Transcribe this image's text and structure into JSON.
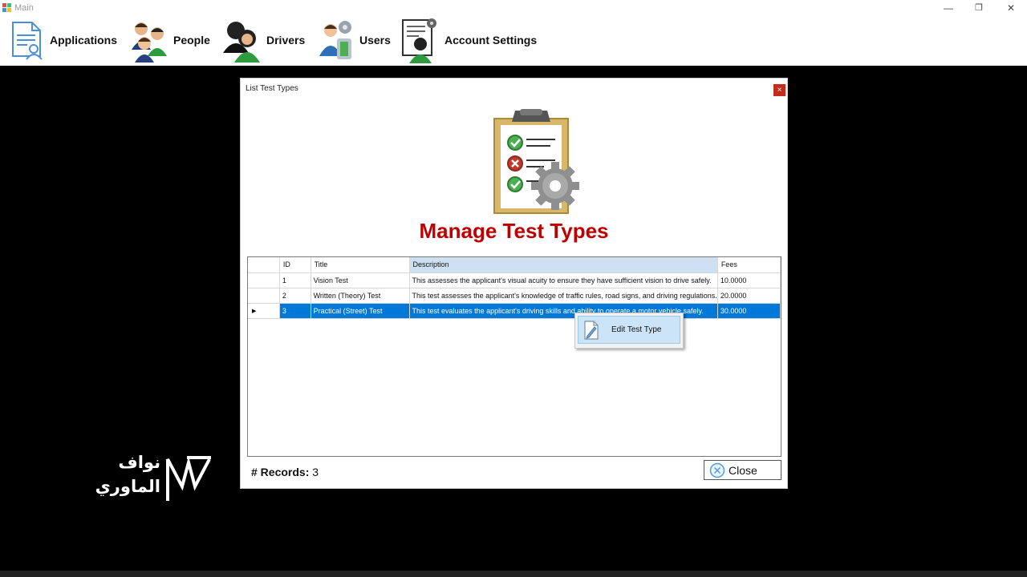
{
  "window": {
    "title": "Main"
  },
  "menu": {
    "applications": "Applications",
    "people": "People",
    "drivers": "Drivers",
    "users": "Users",
    "account_settings": "Account Settings"
  },
  "dialog": {
    "title": "List Test Types",
    "close_x": "×",
    "heading": "Manage Test Types",
    "records_label": "# Records:",
    "records_count": "3",
    "close_button": "Close"
  },
  "table": {
    "columns": [
      "ID",
      "Title",
      "Description",
      "Fees"
    ],
    "selected_column": "Description",
    "rows": [
      {
        "id": "1",
        "title": "Vision Test",
        "description": "This assesses the applicant's visual acuity to ensure they have sufficient vision to drive safely.",
        "fees": "10.0000"
      },
      {
        "id": "2",
        "title": "Written (Theory) Test",
        "description": "This test assesses the applicant's knowledge of traffic rules, road signs, and driving regulations.",
        "fees": "20.0000"
      },
      {
        "id": "3",
        "title": "Practical (Street) Test",
        "description": "This test evaluates the applicant's driving skills and ability to operate a motor vehicle safely.",
        "fees": "30.0000"
      }
    ],
    "selected_row": 3,
    "row_indicator": "▶"
  },
  "context_menu": {
    "edit": "Edit Test Type"
  },
  "watermark": {
    "line1": "نواف",
    "line2": "الماوري"
  },
  "colors": {
    "heading": "#c00000",
    "selection": "#0078d7",
    "header_selected": "#cfe0f2"
  }
}
